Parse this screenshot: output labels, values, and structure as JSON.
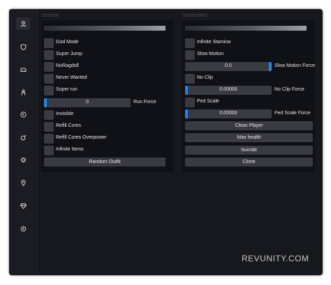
{
  "sidebar": {
    "items": [
      {
        "icon": "user-icon",
        "active": true
      },
      {
        "icon": "shield-icon"
      },
      {
        "icon": "car-icon"
      },
      {
        "icon": "person-icon"
      },
      {
        "icon": "globe-icon"
      },
      {
        "icon": "target-icon"
      },
      {
        "icon": "gear-icon"
      },
      {
        "icon": "map-pin-icon"
      },
      {
        "icon": "diamond-icon"
      },
      {
        "icon": "settings-icon"
      }
    ]
  },
  "panel_left": {
    "title": "General",
    "checkboxes": {
      "god_mode": "God Mode",
      "super_jump": "Super Jump",
      "noragdoll": "NoRagdoll",
      "never_wanted": "Never Wanted",
      "super_run": "Super run",
      "invisible": "Invisible",
      "refill_cores": "Refill Cores",
      "refill_cores_overpower": "Refill Cores Overpower",
      "infinite_items": "Infinite Items"
    },
    "run_force": {
      "value": "0",
      "label": "Run Force"
    },
    "random_outfit": "Random Outfit"
  },
  "panel_right": {
    "title": "General##1",
    "checkboxes": {
      "infinite_stamina": "Infinite Stamina",
      "slow_motion": "Slow Motion",
      "no_clip": "No Clip",
      "ped_scale": "Ped Scale"
    },
    "slow_motion_force": {
      "value": "0.0",
      "label": "Slow Motion Force"
    },
    "no_clip_force": {
      "value": "0.00000",
      "label": "No Clip Force"
    },
    "ped_scale_force": {
      "value": "0.00000",
      "label": "Ped Scale Force"
    },
    "buttons": {
      "clean_player": "Clean Player",
      "max_health": "Max health",
      "suicide": "Suicide",
      "clone": "Clone"
    }
  },
  "watermark": "REVUNITY.COM",
  "colors": {
    "accent": "#1b86f0",
    "window_bg": "#17181d",
    "panel_bg": "#101116",
    "control_bg": "#3a3b42",
    "text": "#e8e8ea"
  }
}
